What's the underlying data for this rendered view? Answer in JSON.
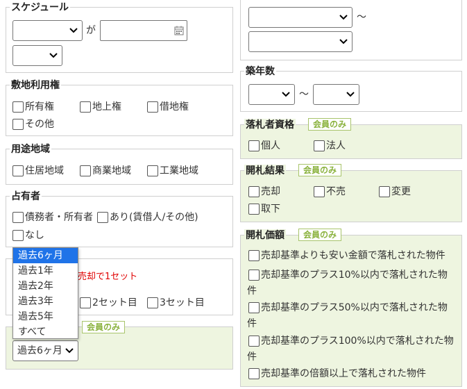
{
  "schedule": {
    "legend": "スケジュール",
    "select1_value": "",
    "connector": "が",
    "date_value": "",
    "select2_value": ""
  },
  "right_top": {
    "select_a_value": "",
    "tilde": "～",
    "select_b_value": ""
  },
  "land_rights": {
    "legend": "敷地利用権",
    "options": [
      "所有権",
      "地上権",
      "借地権",
      "その他"
    ]
  },
  "building_age": {
    "legend": "築年数",
    "from_value": "",
    "tilde": "～",
    "to_value": ""
  },
  "bidder_qualification": {
    "legend": "落札者資格",
    "badge": "会員のみ",
    "options": [
      "個人",
      "法人"
    ]
  },
  "zoning": {
    "legend": "用途地域",
    "options": [
      "住居地域",
      "商業地域",
      "工業地域"
    ]
  },
  "opening_result": {
    "legend": "開札結果",
    "badge": "会員のみ",
    "options": [
      "売却",
      "不売",
      "変更",
      "取下"
    ]
  },
  "occupant": {
    "legend": "占有者",
    "options": [
      "債務者・所有者",
      "あり(賃借人/その他)",
      "なし"
    ]
  },
  "opening_price": {
    "legend": "開札価額",
    "badge": "会員のみ",
    "options": [
      "売却基準よりも安い金額で落札された物件",
      "売却基準のプラス10%以内で落札された物件",
      "売却基準のプラス50%以内で落札された物件",
      "売却基準のプラス100%以内で落札された物件",
      "売却基準の倍額以上で落札された物件"
    ]
  },
  "set_section": {
    "note_partial": "売却で1セット",
    "options": [
      "2セット目",
      "3セット目"
    ]
  },
  "period_section": {
    "badge": "会員のみ",
    "selected": "過去6ヶ月",
    "options": [
      "過去6ヶ月",
      "過去1年",
      "過去2年",
      "過去3年",
      "過去5年",
      "すべて"
    ]
  },
  "colors": {
    "accent_green": "#8ab23d",
    "green_bg": "#eef5e0",
    "red_note": "#e00000",
    "highlight": "#1f73e8"
  }
}
